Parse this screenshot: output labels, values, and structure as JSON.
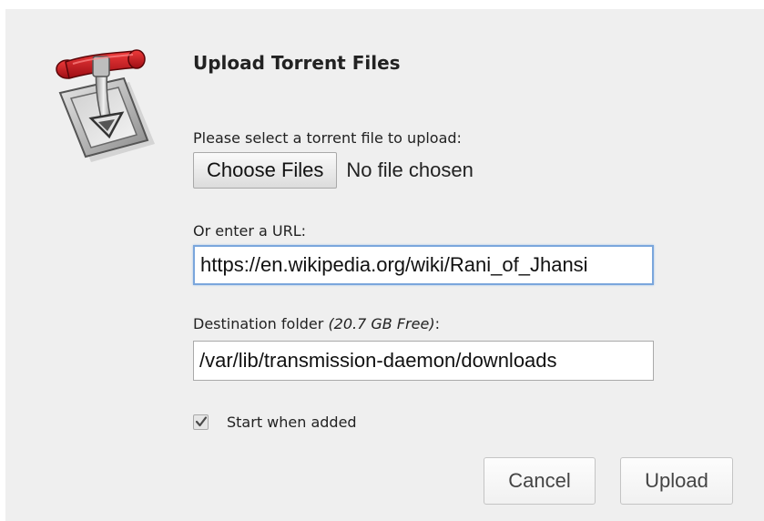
{
  "dialog": {
    "title": "Upload Torrent Files",
    "logo_icon": "transmission-logo-icon"
  },
  "file_select": {
    "label": "Please select a torrent file to upload:",
    "button_label": "Choose Files",
    "status": "No file chosen"
  },
  "url": {
    "label": "Or enter a URL:",
    "value": "https://en.wikipedia.org/wiki/Rani_of_Jhansi"
  },
  "destination": {
    "label": "Destination folder",
    "free_space": "(20.7 GB Free)",
    "suffix": ":",
    "value": "/var/lib/transmission-daemon/downloads"
  },
  "start_when_added": {
    "label": "Start when added",
    "checked": true
  },
  "buttons": {
    "cancel": "Cancel",
    "upload": "Upload"
  },
  "colors": {
    "dialog_bg": "#efefef",
    "focus_border": "#7aa6dc",
    "logo_red": "#c8141e"
  }
}
